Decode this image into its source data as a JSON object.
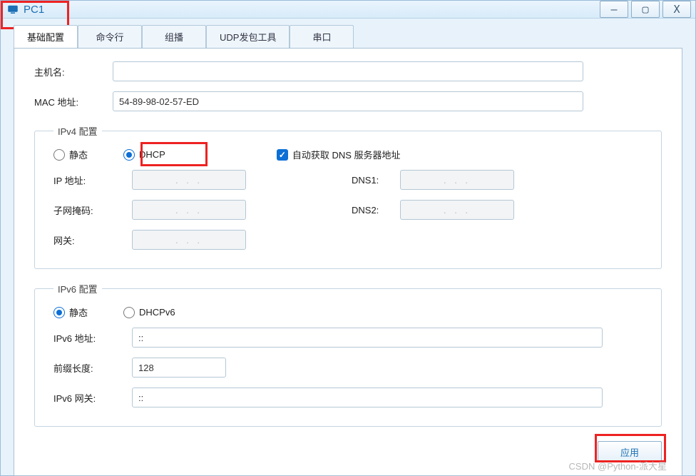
{
  "window": {
    "title": "PC1",
    "controls": {
      "min": "—",
      "max": "▢",
      "close": "X"
    }
  },
  "tabs": [
    "基础配置",
    "命令行",
    "组播",
    "UDP发包工具",
    "串口"
  ],
  "active_tab": 0,
  "basic": {
    "hostname_label": "主机名:",
    "hostname_value": "",
    "mac_label": "MAC 地址:",
    "mac_value": "54-89-98-02-57-ED"
  },
  "ipv4": {
    "legend": "IPv4 配置",
    "static_label": "静态",
    "dhcp_label": "DHCP",
    "mode": "dhcp",
    "auto_dns_label": "自动获取 DNS 服务器地址",
    "auto_dns_checked": true,
    "ip_label": "IP 地址:",
    "ip_value": ".       .       .",
    "mask_label": "子网掩码:",
    "mask_value": ".       .       .",
    "gw_label": "网关:",
    "gw_value": ".       .       .",
    "dns1_label": "DNS1:",
    "dns1_value": ".       .       .",
    "dns2_label": "DNS2:",
    "dns2_value": ".       .       ."
  },
  "ipv6": {
    "legend": "IPv6 配置",
    "static_label": "静态",
    "dhcp_label": "DHCPv6",
    "mode": "static",
    "addr_label": "IPv6 地址:",
    "addr_value": "::",
    "prefix_label": "前缀长度:",
    "prefix_value": "128",
    "gw_label": "IPv6 网关:",
    "gw_value": "::"
  },
  "apply_label": "应用",
  "watermark": "CSDN @Python-派大星"
}
